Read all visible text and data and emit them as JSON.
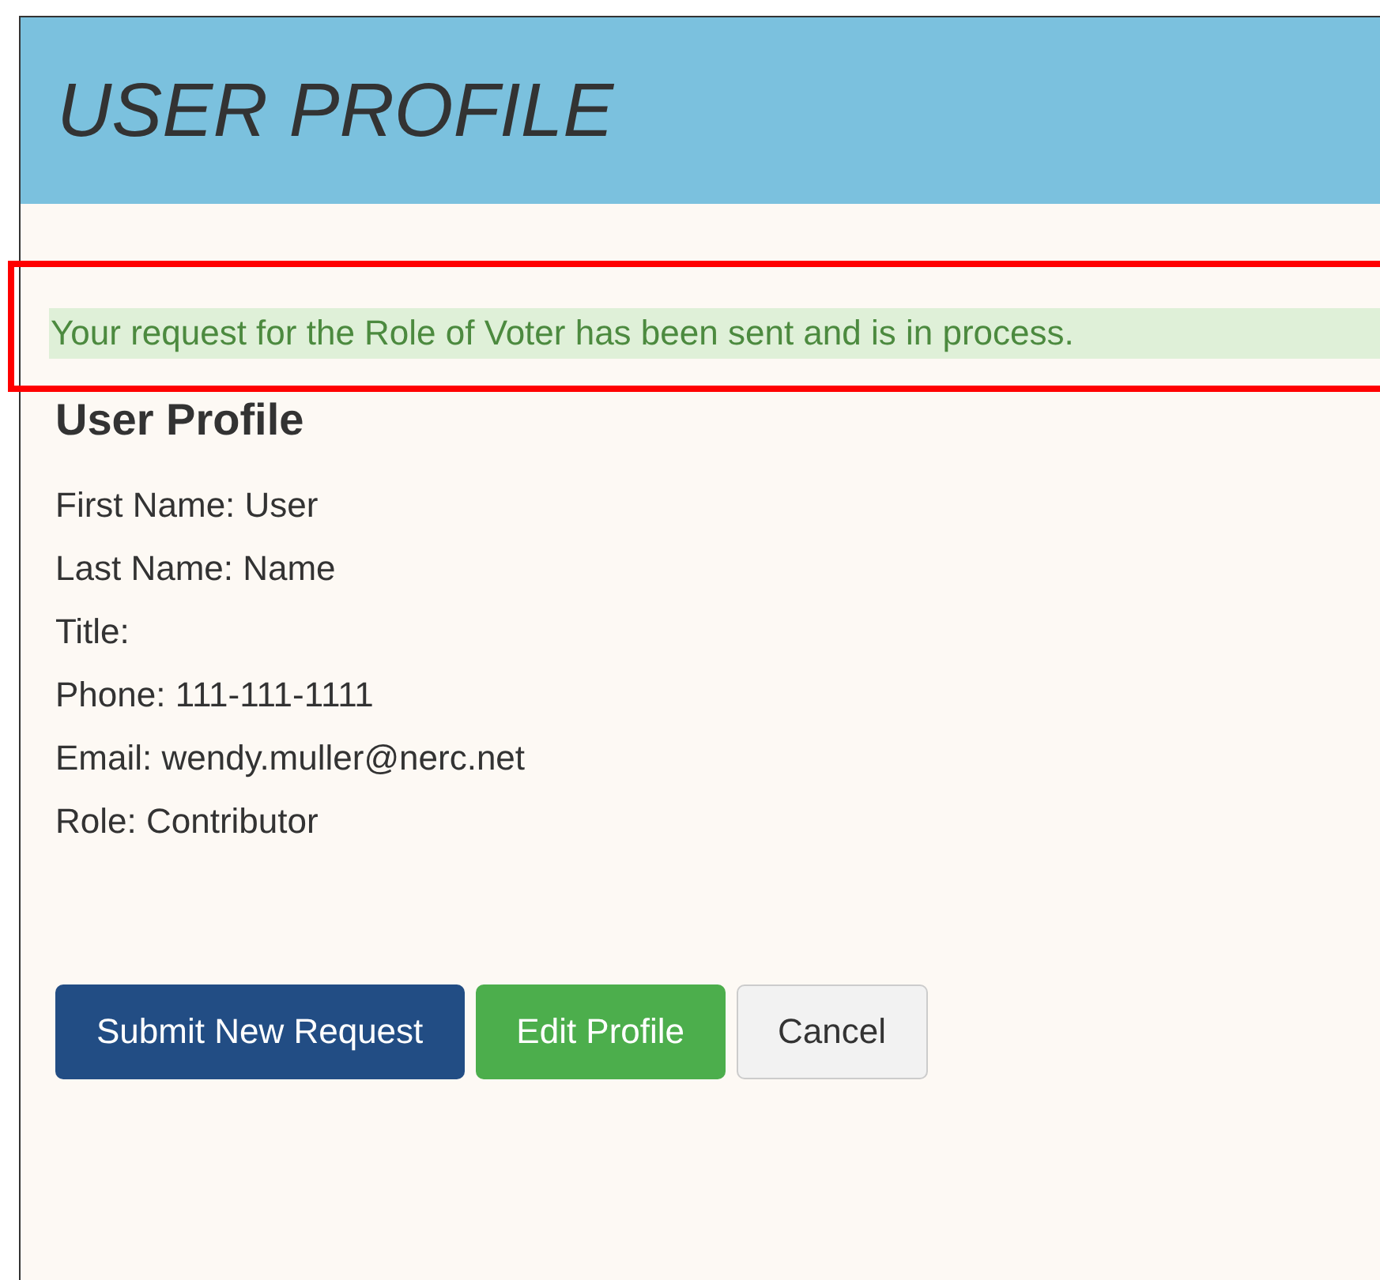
{
  "header": {
    "title": "USER PROFILE"
  },
  "alert": {
    "message": "Your request for the Role of Voter has been sent and is in process.",
    "highlighted": true
  },
  "profile": {
    "heading": "User Profile",
    "fields": [
      "First Name: User",
      "Last Name: Name",
      "Title:",
      "Phone: 111-111-1111",
      "Email: wendy.muller@nerc.net",
      "Role: Contributor"
    ]
  },
  "buttons": [
    {
      "label": "Submit New Request",
      "kind": "primary"
    },
    {
      "label": "Edit Profile",
      "kind": "success"
    },
    {
      "label": "Cancel",
      "kind": "default"
    }
  ]
}
